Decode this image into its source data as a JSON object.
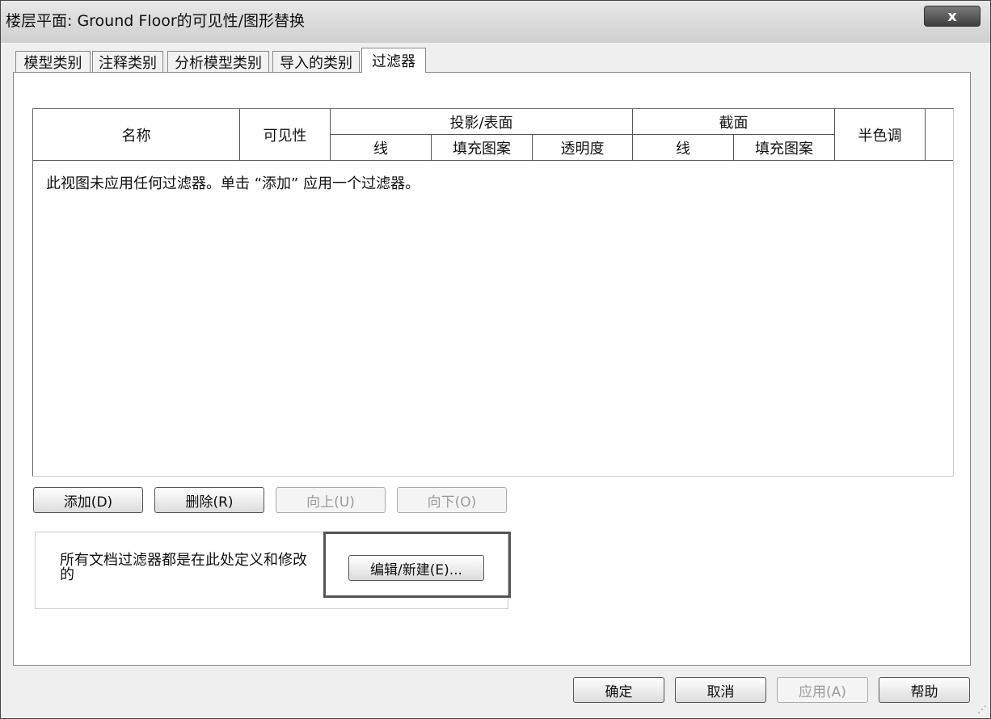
{
  "window": {
    "title": "楼层平面: Ground Floor的可见性/图形替换",
    "close_label": "x"
  },
  "tabs": [
    {
      "label": "模型类别"
    },
    {
      "label": "注释类别"
    },
    {
      "label": "分析模型类别"
    },
    {
      "label": "导入的类别"
    },
    {
      "label": "过滤器"
    }
  ],
  "active_tab": "过滤器",
  "table": {
    "headers": {
      "name": "名称",
      "visibility": "可见性",
      "projection_group": "投影/表面",
      "projection_lines": "线",
      "projection_patterns": "填充图案",
      "projection_transparency": "透明度",
      "cut_group": "截面",
      "cut_lines": "线",
      "cut_patterns": "填充图案",
      "halftone": "半色调"
    },
    "empty_message": "此视图未应用任何过滤器。单击 “添加” 应用一个过滤器。"
  },
  "row_buttons": {
    "add": "添加(D)",
    "remove": "删除(R)",
    "up": "向上(U)",
    "down": "向下(O)"
  },
  "filters_group": {
    "description": "所有文档过滤器都是在此处定义和修改的",
    "edit_new_label": "编辑/新建(E)..."
  },
  "footer": {
    "ok": "确定",
    "cancel": "取消",
    "apply": "应用(A)",
    "help": "帮助"
  }
}
